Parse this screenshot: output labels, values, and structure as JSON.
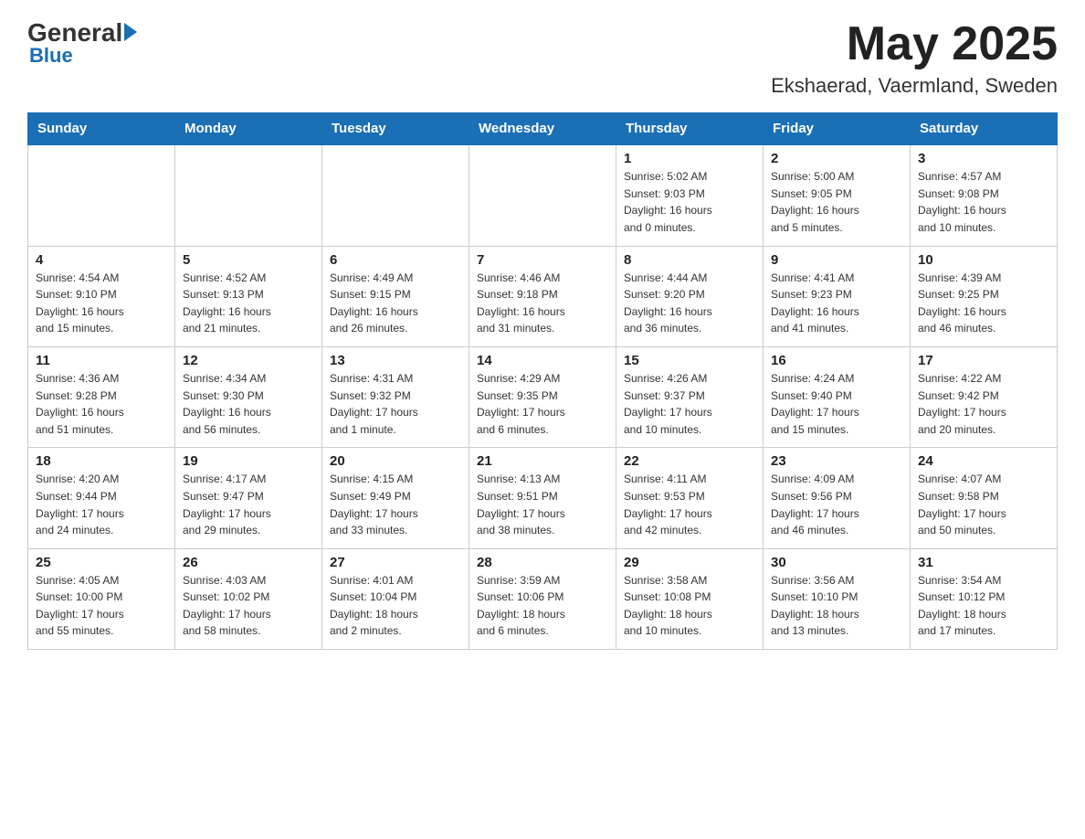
{
  "header": {
    "logo_general": "General",
    "logo_blue": "Blue",
    "month_year": "May 2025",
    "location": "Ekshaerad, Vaermland, Sweden"
  },
  "weekdays": [
    "Sunday",
    "Monday",
    "Tuesday",
    "Wednesday",
    "Thursday",
    "Friday",
    "Saturday"
  ],
  "weeks": [
    [
      {
        "day": "",
        "info": ""
      },
      {
        "day": "",
        "info": ""
      },
      {
        "day": "",
        "info": ""
      },
      {
        "day": "",
        "info": ""
      },
      {
        "day": "1",
        "info": "Sunrise: 5:02 AM\nSunset: 9:03 PM\nDaylight: 16 hours\nand 0 minutes."
      },
      {
        "day": "2",
        "info": "Sunrise: 5:00 AM\nSunset: 9:05 PM\nDaylight: 16 hours\nand 5 minutes."
      },
      {
        "day": "3",
        "info": "Sunrise: 4:57 AM\nSunset: 9:08 PM\nDaylight: 16 hours\nand 10 minutes."
      }
    ],
    [
      {
        "day": "4",
        "info": "Sunrise: 4:54 AM\nSunset: 9:10 PM\nDaylight: 16 hours\nand 15 minutes."
      },
      {
        "day": "5",
        "info": "Sunrise: 4:52 AM\nSunset: 9:13 PM\nDaylight: 16 hours\nand 21 minutes."
      },
      {
        "day": "6",
        "info": "Sunrise: 4:49 AM\nSunset: 9:15 PM\nDaylight: 16 hours\nand 26 minutes."
      },
      {
        "day": "7",
        "info": "Sunrise: 4:46 AM\nSunset: 9:18 PM\nDaylight: 16 hours\nand 31 minutes."
      },
      {
        "day": "8",
        "info": "Sunrise: 4:44 AM\nSunset: 9:20 PM\nDaylight: 16 hours\nand 36 minutes."
      },
      {
        "day": "9",
        "info": "Sunrise: 4:41 AM\nSunset: 9:23 PM\nDaylight: 16 hours\nand 41 minutes."
      },
      {
        "day": "10",
        "info": "Sunrise: 4:39 AM\nSunset: 9:25 PM\nDaylight: 16 hours\nand 46 minutes."
      }
    ],
    [
      {
        "day": "11",
        "info": "Sunrise: 4:36 AM\nSunset: 9:28 PM\nDaylight: 16 hours\nand 51 minutes."
      },
      {
        "day": "12",
        "info": "Sunrise: 4:34 AM\nSunset: 9:30 PM\nDaylight: 16 hours\nand 56 minutes."
      },
      {
        "day": "13",
        "info": "Sunrise: 4:31 AM\nSunset: 9:32 PM\nDaylight: 17 hours\nand 1 minute."
      },
      {
        "day": "14",
        "info": "Sunrise: 4:29 AM\nSunset: 9:35 PM\nDaylight: 17 hours\nand 6 minutes."
      },
      {
        "day": "15",
        "info": "Sunrise: 4:26 AM\nSunset: 9:37 PM\nDaylight: 17 hours\nand 10 minutes."
      },
      {
        "day": "16",
        "info": "Sunrise: 4:24 AM\nSunset: 9:40 PM\nDaylight: 17 hours\nand 15 minutes."
      },
      {
        "day": "17",
        "info": "Sunrise: 4:22 AM\nSunset: 9:42 PM\nDaylight: 17 hours\nand 20 minutes."
      }
    ],
    [
      {
        "day": "18",
        "info": "Sunrise: 4:20 AM\nSunset: 9:44 PM\nDaylight: 17 hours\nand 24 minutes."
      },
      {
        "day": "19",
        "info": "Sunrise: 4:17 AM\nSunset: 9:47 PM\nDaylight: 17 hours\nand 29 minutes."
      },
      {
        "day": "20",
        "info": "Sunrise: 4:15 AM\nSunset: 9:49 PM\nDaylight: 17 hours\nand 33 minutes."
      },
      {
        "day": "21",
        "info": "Sunrise: 4:13 AM\nSunset: 9:51 PM\nDaylight: 17 hours\nand 38 minutes."
      },
      {
        "day": "22",
        "info": "Sunrise: 4:11 AM\nSunset: 9:53 PM\nDaylight: 17 hours\nand 42 minutes."
      },
      {
        "day": "23",
        "info": "Sunrise: 4:09 AM\nSunset: 9:56 PM\nDaylight: 17 hours\nand 46 minutes."
      },
      {
        "day": "24",
        "info": "Sunrise: 4:07 AM\nSunset: 9:58 PM\nDaylight: 17 hours\nand 50 minutes."
      }
    ],
    [
      {
        "day": "25",
        "info": "Sunrise: 4:05 AM\nSunset: 10:00 PM\nDaylight: 17 hours\nand 55 minutes."
      },
      {
        "day": "26",
        "info": "Sunrise: 4:03 AM\nSunset: 10:02 PM\nDaylight: 17 hours\nand 58 minutes."
      },
      {
        "day": "27",
        "info": "Sunrise: 4:01 AM\nSunset: 10:04 PM\nDaylight: 18 hours\nand 2 minutes."
      },
      {
        "day": "28",
        "info": "Sunrise: 3:59 AM\nSunset: 10:06 PM\nDaylight: 18 hours\nand 6 minutes."
      },
      {
        "day": "29",
        "info": "Sunrise: 3:58 AM\nSunset: 10:08 PM\nDaylight: 18 hours\nand 10 minutes."
      },
      {
        "day": "30",
        "info": "Sunrise: 3:56 AM\nSunset: 10:10 PM\nDaylight: 18 hours\nand 13 minutes."
      },
      {
        "day": "31",
        "info": "Sunrise: 3:54 AM\nSunset: 10:12 PM\nDaylight: 18 hours\nand 17 minutes."
      }
    ]
  ]
}
